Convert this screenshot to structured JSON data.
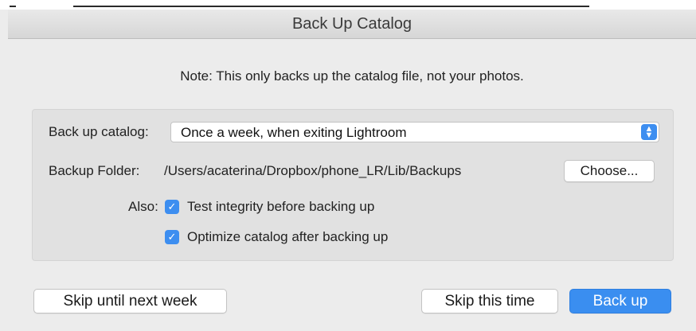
{
  "window": {
    "title": "Back Up Catalog"
  },
  "note": "Note: This only backs up the catalog file, not your photos.",
  "settings": {
    "catalog_label": "Back up catalog:",
    "catalog_value": "Once a week, when exiting Lightroom",
    "folder_label": "Backup Folder:",
    "folder_path": "/Users/acaterina/Dropbox/phone_LR/Lib/Backups",
    "choose_button": "Choose...",
    "also_label": "Also:",
    "options": [
      {
        "label": "Test integrity before backing up",
        "checked": true
      },
      {
        "label": "Optimize catalog after backing up",
        "checked": true
      }
    ]
  },
  "buttons": {
    "skip_week": "Skip until next week",
    "skip_time": "Skip this time",
    "back_up": "Back up"
  },
  "colors": {
    "accent": "#3a8ef0",
    "background": "#ececec",
    "group": "#e1e1e1"
  },
  "icons": {
    "popup": "up-down-chevron-icon",
    "checkbox": "checkmark-icon"
  }
}
